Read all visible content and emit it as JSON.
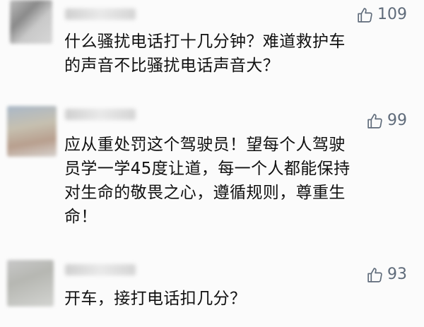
{
  "comments": [
    {
      "likes": "109",
      "text": "什么骚扰电话打十几分钟？难道救护车\n的声音不比骚扰电话声音大？"
    },
    {
      "likes": "99",
      "text": "应从重处罚这个驾驶员！望每个人驾驶\n员学一学45度让道，每一个人都能保持\n对生命的敬畏之心，遵循规则，尊重生\n命！"
    },
    {
      "likes": "93",
      "text": "开车，接打电话扣几分？"
    }
  ],
  "colors": {
    "like": "#5f6b7a",
    "text": "#111111",
    "background": "#fbfbfb"
  },
  "icons": {
    "like": "thumbs-up-icon"
  }
}
